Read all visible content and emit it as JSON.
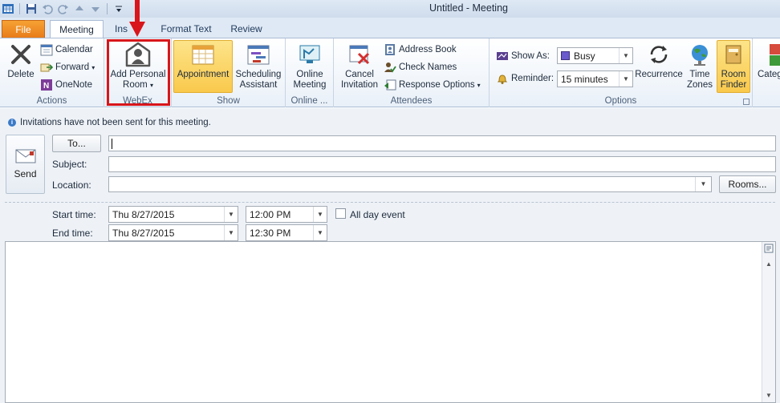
{
  "window": {
    "title": "Untitled - Meeting"
  },
  "tabs": [
    {
      "label": "File"
    },
    {
      "label": "Meeting"
    },
    {
      "label": "Ins"
    },
    {
      "label": "Format Text"
    },
    {
      "label": "Review"
    }
  ],
  "ribbon": {
    "actions": {
      "delete": "Delete",
      "calendar": "Calendar",
      "forward": "Forward",
      "onenote": "OneNote",
      "group_label": "Actions"
    },
    "webex": {
      "add_personal_room_line1": "Add Personal",
      "add_personal_room_line2": "Room",
      "group_label": "WebEx"
    },
    "show": {
      "appointment": "Appointment",
      "scheduling_line1": "Scheduling",
      "scheduling_line2": "Assistant",
      "group_label": "Show"
    },
    "online": {
      "line1": "Online",
      "line2": "Meeting",
      "group_label": "Online ..."
    },
    "attendees": {
      "cancel_line1": "Cancel",
      "cancel_line2": "Invitation",
      "address_book": "Address Book",
      "check_names": "Check Names",
      "response_options": "Response Options",
      "group_label": "Attendees"
    },
    "options": {
      "show_as_label": "Show As:",
      "show_as_value": "Busy",
      "reminder_label": "Reminder:",
      "reminder_value": "15 minutes",
      "recurrence": "Recurrence",
      "time_zones_line1": "Time",
      "time_zones_line2": "Zones",
      "room_finder_line1": "Room",
      "room_finder_line2": "Finder",
      "group_label": "Options"
    },
    "tags": {
      "categorize_partial": "Categ"
    }
  },
  "form": {
    "info_message": "Invitations have not been sent for this meeting.",
    "send_label": "Send",
    "to_button": "To...",
    "to_value": "",
    "subject_label": "Subject:",
    "subject_value": "",
    "location_label": "Location:",
    "location_value": "",
    "rooms_button": "Rooms...",
    "start_time_label": "Start time:",
    "start_date": "Thu 8/27/2015",
    "start_time": "12:00 PM",
    "end_time_label": "End time:",
    "end_date": "Thu 8/27/2015",
    "end_time": "12:30 PM",
    "all_day_label": "All day event",
    "all_day_checked": false
  },
  "colors": {
    "file_tab": "#e77a17",
    "highlight": "#f9c94c",
    "annotation_red": "#d8161b",
    "busy_swatch": "#6a5acd"
  }
}
